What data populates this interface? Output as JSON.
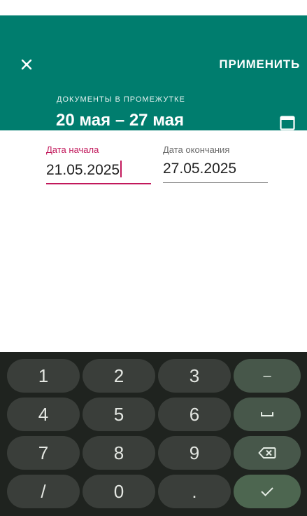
{
  "header": {
    "close_icon": "close-icon",
    "apply_label": "ПРИМЕНИТЬ",
    "range_label": "ДОКУМЕНТЫ В ПРОМЕЖУТКЕ",
    "range_value": "20 мая – 27 мая",
    "calendar_icon": "calendar-icon",
    "bg_color": "#007d6e"
  },
  "form": {
    "start_label": "Дата начала",
    "start_value": "21.05.2025",
    "end_label": "Дата окончания",
    "end_value": "27.05.2025",
    "active_color": "#c2185b"
  },
  "keyboard": {
    "keys": {
      "k1": "1",
      "k2": "2",
      "k3": "3",
      "minus": "–",
      "k4": "4",
      "k5": "5",
      "k6": "6",
      "k7": "7",
      "k8": "8",
      "k9": "9",
      "slash": "/",
      "k0": "0",
      "dot": "."
    },
    "icons": [
      "space-icon",
      "backspace-icon",
      "checkmark-icon"
    ]
  }
}
